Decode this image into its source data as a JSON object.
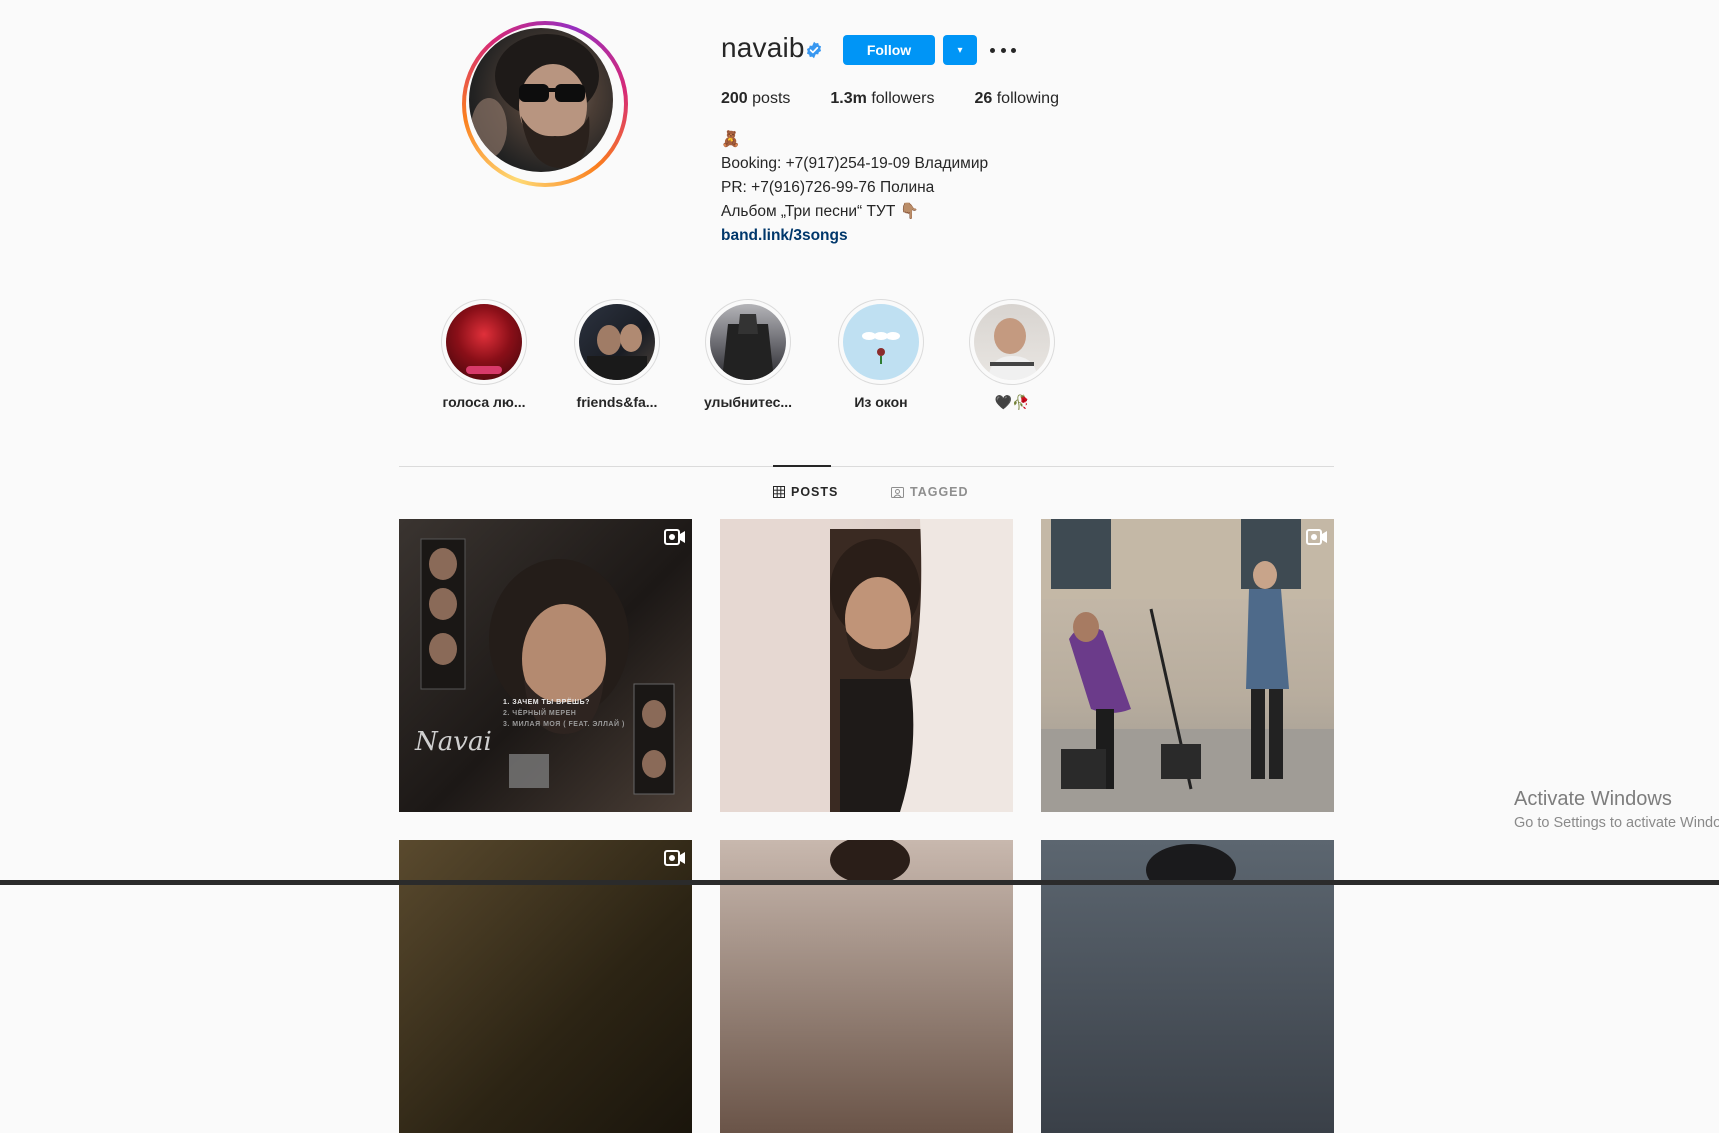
{
  "profile": {
    "username": "navaib",
    "verified_icon": "verified-badge-icon",
    "follow_label": "Follow",
    "dropdown_icon": "▾",
    "more_icon": "more-options-icon"
  },
  "stats": {
    "posts_count": "200",
    "posts_label": "posts",
    "followers_count": "1.3m",
    "followers_label": "followers",
    "following_count": "26",
    "following_label": "following"
  },
  "bio": {
    "emoji": "🧸",
    "line1": "Booking: +7(917)254-19-09 Владимир",
    "line2": "PR: +7(916)726-99-76 Полина",
    "line3": "Альбом „Три песни“ ТУТ 👇🏽",
    "link": "band.link/3songs"
  },
  "highlights": [
    {
      "label": "голоса лю..."
    },
    {
      "label": "friends&fa..."
    },
    {
      "label": "улыбнитес..."
    },
    {
      "label": "Из окон"
    },
    {
      "label": "🖤🥀"
    }
  ],
  "tabs": {
    "posts": "POSTS",
    "tagged": "TAGGED"
  },
  "posts": [
    {
      "type": "reel",
      "caption_lines": [
        "1. ЗАЧЕМ ТЫ ВРЁШЬ?",
        "2. ЧЁРНЫЙ МЕРЕН",
        "3. МИЛАЯ МОЯ ( FEAT. ЭЛЛАЙ )"
      ],
      "signature": "Navai"
    },
    {
      "type": "photo"
    },
    {
      "type": "reel"
    },
    {
      "type": "reel"
    },
    {
      "type": "photo"
    },
    {
      "type": "photo"
    }
  ],
  "colors": {
    "accent": "#0095f6",
    "background": "#fafafa",
    "link": "#00376b"
  },
  "os_overlay": {
    "title": "Activate Windows",
    "subtitle": "Go to Settings to activate Windows."
  }
}
